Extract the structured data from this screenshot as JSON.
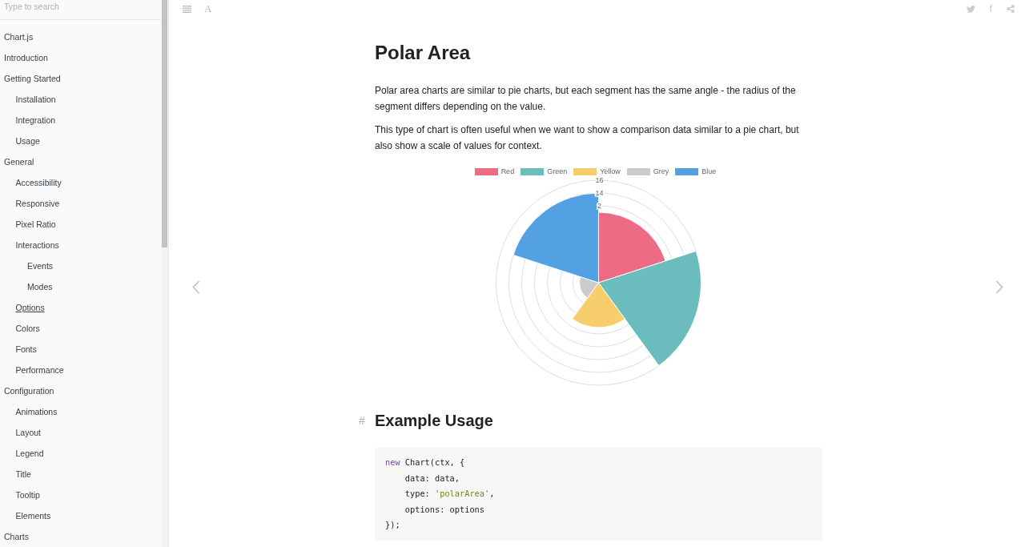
{
  "sidebar": {
    "search": {
      "placeholder": "Type to search"
    },
    "items": [
      {
        "label": "Chart.js",
        "hovered": false
      },
      {
        "label": "Introduction",
        "hovered": false
      },
      {
        "label": "Getting Started",
        "hovered": false,
        "children": [
          {
            "label": "Installation",
            "hovered": false
          },
          {
            "label": "Integration",
            "hovered": false
          },
          {
            "label": "Usage",
            "hovered": false
          }
        ]
      },
      {
        "label": "General",
        "hovered": false,
        "children": [
          {
            "label": "Accessibility",
            "hovered": false
          },
          {
            "label": "Responsive",
            "hovered": false
          },
          {
            "label": "Pixel Ratio",
            "hovered": false
          },
          {
            "label": "Interactions",
            "hovered": false,
            "children": [
              {
                "label": "Events",
                "hovered": false
              },
              {
                "label": "Modes",
                "hovered": false
              }
            ]
          },
          {
            "label": "Options",
            "hovered": true
          },
          {
            "label": "Colors",
            "hovered": false
          },
          {
            "label": "Fonts",
            "hovered": false
          },
          {
            "label": "Performance",
            "hovered": false
          }
        ]
      },
      {
        "label": "Configuration",
        "hovered": false,
        "children": [
          {
            "label": "Animations",
            "hovered": false
          },
          {
            "label": "Layout",
            "hovered": false
          },
          {
            "label": "Legend",
            "hovered": false
          },
          {
            "label": "Title",
            "hovered": false
          },
          {
            "label": "Tooltip",
            "hovered": false
          },
          {
            "label": "Elements",
            "hovered": false
          }
        ]
      },
      {
        "label": "Charts",
        "hovered": false
      }
    ]
  },
  "toolbar": {
    "font_button": "A",
    "facebook_button": "f"
  },
  "article": {
    "title": "Polar Area",
    "paragraphs": [
      "Polar area charts are similar to pie charts, but each segment has the same angle - the radius of the segment differs depending on the value.",
      "This type of chart is often useful when we want to show a comparison data similar to a pie chart, but also show a scale of values for context."
    ],
    "chart": {
      "legend": [
        {
          "label": "Red",
          "color": "#ed6b85"
        },
        {
          "label": "Green",
          "color": "#6bbcbd"
        },
        {
          "label": "Yellow",
          "color": "#f7ce6b"
        },
        {
          "label": "Grey",
          "color": "#c9cbcf"
        },
        {
          "label": "Blue",
          "color": "#53a0e2"
        }
      ],
      "scale_labels": [
        "16",
        "14",
        "2"
      ]
    },
    "sections": [
      {
        "anchor": "#",
        "heading": "Example Usage",
        "code": [
          [
            {
              "kind": "keyword",
              "text": "new"
            },
            {
              "kind": "plain",
              "text": " Chart(ctx, {"
            }
          ],
          [
            {
              "kind": "plain",
              "text": "    data: data,"
            }
          ],
          [
            {
              "kind": "plain",
              "text": "    type: "
            },
            {
              "kind": "string",
              "text": "'polarArea'"
            },
            {
              "kind": "plain",
              "text": ","
            }
          ],
          [
            {
              "kind": "plain",
              "text": "    options: options"
            }
          ],
          [
            {
              "kind": "plain",
              "text": "});"
            }
          ]
        ]
      }
    ]
  }
}
